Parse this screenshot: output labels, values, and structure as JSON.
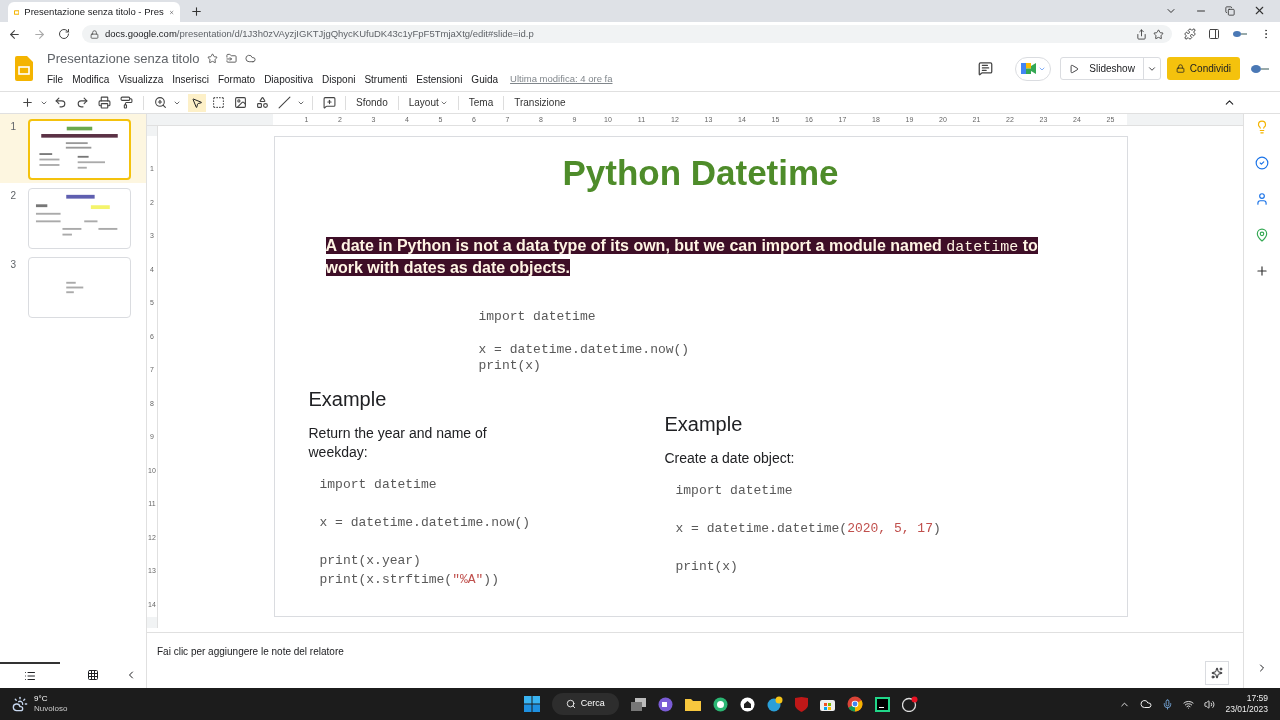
{
  "browser": {
    "tab_title": "Presentazione senza titolo - Pres",
    "url_host": "docs.google.com",
    "url_path": "/presentation/d/1J3h0zVAyzjIGKTJjgQhycKUfuDK43c1yFpF5TmjaXtg/edit#slide=id.p"
  },
  "doc": {
    "title": "Presentazione senza titolo",
    "menu": [
      "File",
      "Modifica",
      "Visualizza",
      "Inserisci",
      "Formato",
      "Diapositiva",
      "Disponi",
      "Strumenti",
      "Estensioni",
      "Guida"
    ],
    "last_edit": "Ultima modifica: 4 ore fa",
    "slideshow_label": "Slideshow",
    "share_label": "Condividi"
  },
  "toolbar": {
    "buttons": [
      {
        "label": "Sfondo",
        "dropdown": false
      },
      {
        "label": "Layout",
        "dropdown": true
      },
      {
        "label": "Tema",
        "dropdown": false
      },
      {
        "label": "Transizione",
        "dropdown": false
      }
    ]
  },
  "filmstrip": {
    "slides": [
      {
        "number": "1",
        "selected": true
      },
      {
        "number": "2",
        "selected": false
      },
      {
        "number": "3",
        "selected": false
      }
    ]
  },
  "ruler": {
    "horizontal": [
      "1",
      "2",
      "3",
      "4",
      "5",
      "6",
      "7",
      "8",
      "9",
      "10",
      "11",
      "12",
      "13",
      "14",
      "15",
      "16",
      "17",
      "18",
      "19",
      "20",
      "21",
      "22",
      "23",
      "24",
      "25"
    ],
    "vertical": [
      "1",
      "2",
      "3",
      "4",
      "5",
      "6",
      "7",
      "8",
      "9",
      "10",
      "11",
      "12",
      "13",
      "14"
    ]
  },
  "slide": {
    "title": "Python Datetime",
    "intro": [
      {
        "text": "A date in Python is not a data type of its own, but we can import a module named ",
        "code": false
      },
      {
        "text": "datetime",
        "code": true
      },
      {
        "text": " to work with dates as date objects.",
        "code": false
      }
    ],
    "code_main": [
      [
        [
          {
            "text": "import datetime",
            "kind": "code"
          }
        ]
      ],
      [
        [
          {
            "text": "x = datetime.datetime.now()",
            "kind": "code"
          }
        ],
        [
          {
            "text": "print(x)",
            "kind": "code"
          }
        ]
      ]
    ],
    "examples": [
      {
        "heading": "Example",
        "description": "Return the year and name of weekday:",
        "code": [
          [
            [
              {
                "text": "import datetime",
                "kind": "code"
              }
            ]
          ],
          [
            [
              {
                "text": "x = datetime.datetime.now()",
                "kind": "code"
              }
            ]
          ],
          [
            [
              {
                "text": "print(x.year)",
                "kind": "code"
              }
            ],
            [
              {
                "text": "print(x.strftime(",
                "kind": "code"
              },
              {
                "text": "\"%A\"",
                "kind": "literal"
              },
              {
                "text": "))",
                "kind": "code"
              }
            ]
          ]
        ]
      },
      {
        "heading": "Example",
        "description": "Create a date object:",
        "code": [
          [
            [
              {
                "text": "import datetime",
                "kind": "code"
              }
            ]
          ],
          [
            [
              {
                "text": "x = datetime.datetime(",
                "kind": "code"
              },
              {
                "text": "2020, 5, 17",
                "kind": "literal"
              },
              {
                "text": ")",
                "kind": "code"
              }
            ]
          ],
          [
            [
              {
                "text": "print(x)",
                "kind": "code"
              }
            ]
          ]
        ]
      }
    ]
  },
  "notes": {
    "placeholder": "Fai clic per aggiungere le note del relatore"
  },
  "taskbar": {
    "temperature": "9°C",
    "weather": "Nuvoloso",
    "search_label": "Cerca",
    "time": "17:59",
    "date": "23/01/2023"
  }
}
